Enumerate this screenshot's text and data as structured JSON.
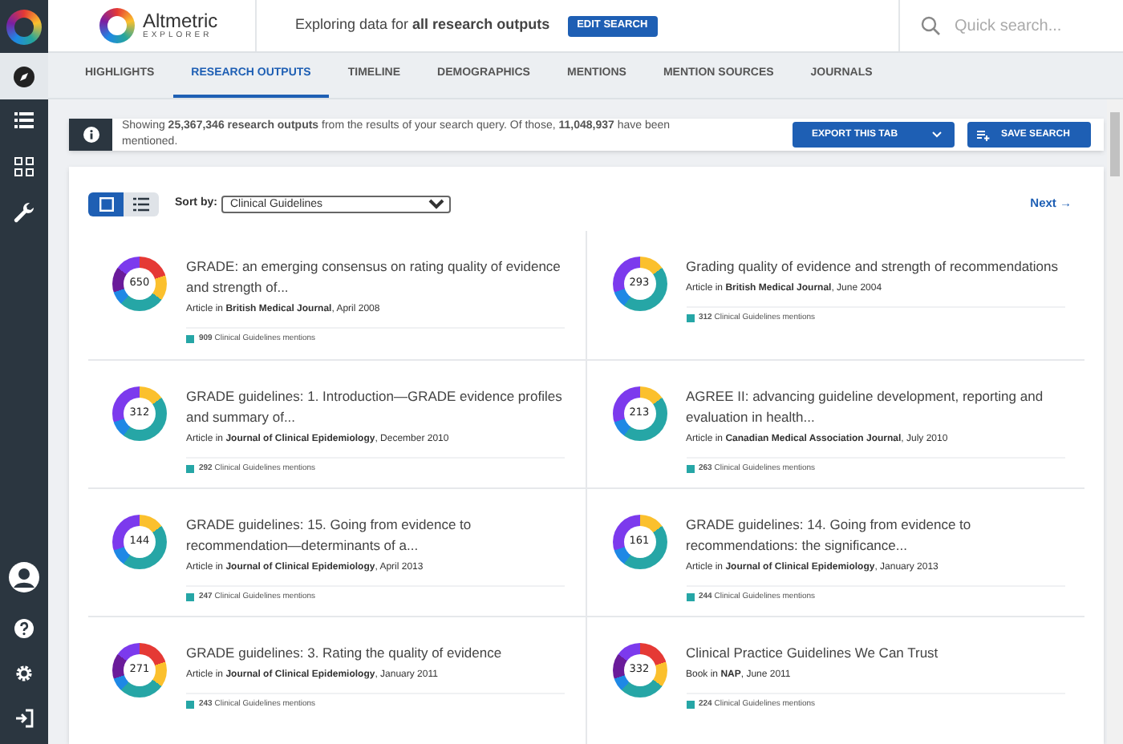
{
  "brand": {
    "name": "Altmetric",
    "subtitle": "EXPLORER"
  },
  "context": {
    "text": "Exploring data for **all research outputs**",
    "button": "EDIT SEARCH"
  },
  "search": {
    "placeholder": "Quick search..."
  },
  "tabs": [
    {
      "label": "HIGHLIGHTS",
      "selected": false
    },
    {
      "label": "RESEARCH OUTPUTS",
      "selected": true
    },
    {
      "label": "TIMELINE",
      "selected": false
    },
    {
      "label": "DEMOGRAPHICS",
      "selected": false
    },
    {
      "label": "MENTIONS",
      "selected": false
    },
    {
      "label": "MENTION SOURCES",
      "selected": false
    },
    {
      "label": "JOURNALS",
      "selected": false
    }
  ],
  "info": {
    "text": "Showing **25,367,346 research outputs** from the results of your search query. Of those, **11,048,937** have been mentioned.",
    "export_button": "EXPORT THIS TAB",
    "save_button": "SAVE SEARCH"
  },
  "views": [
    {
      "kind": "grid",
      "selected": true
    },
    {
      "kind": "list",
      "selected": false
    }
  ],
  "sort": {
    "label": "Sort by:",
    "value": "Clinical Guidelines"
  },
  "next": "Next →",
  "outputs": [
    {
      "score": "650",
      "title": "GRADE: an emerging consensus on rating quality of evidence and strength of...",
      "meta": "Article in **British Medical Journal**, April 2008",
      "mentions": "**909** Clinical Guidelines mentions"
    },
    {
      "score": "293",
      "title": "Grading quality of evidence and strength of recommendations",
      "meta": "Article in **British Medical Journal**, June 2004",
      "mentions": "**312** Clinical Guidelines mentions"
    },
    {
      "score": "312",
      "title": "GRADE guidelines: 1. Introduction—GRADE evidence profiles and summary of...",
      "meta": "Article in **Journal of Clinical Epidemiology**, December 2010",
      "mentions": "**292** Clinical Guidelines mentions"
    },
    {
      "score": "213",
      "title": "AGREE II: advancing guideline development, reporting and evaluation in health...",
      "meta": "Article in **Canadian Medical Association Journal**, July 2010",
      "mentions": "**263** Clinical Guidelines mentions"
    },
    {
      "score": "144",
      "title": "GRADE guidelines: 15. Going from evidence to recommendation—determinants of a...",
      "meta": "Article in **Journal of Clinical Epidemiology**, April 2013",
      "mentions": "**247** Clinical Guidelines mentions"
    },
    {
      "score": "161",
      "title": "GRADE guidelines: 14. Going from evidence to recommendations: the significance...",
      "meta": "Article in **Journal of Clinical Epidemiology**, January 2013",
      "mentions": "**244** Clinical Guidelines mentions"
    },
    {
      "score": "271",
      "title": "GRADE guidelines: 3. Rating the quality of evidence",
      "meta": "Article in **Journal of Clinical Epidemiology**, January 2011",
      "mentions": "**243** Clinical Guidelines mentions"
    },
    {
      "score": "332",
      "title": "Clinical Practice Guidelines We Can Trust",
      "meta": "Book in **NAP**, June 2011",
      "mentions": "**224** Clinical Guidelines mentions"
    }
  ]
}
